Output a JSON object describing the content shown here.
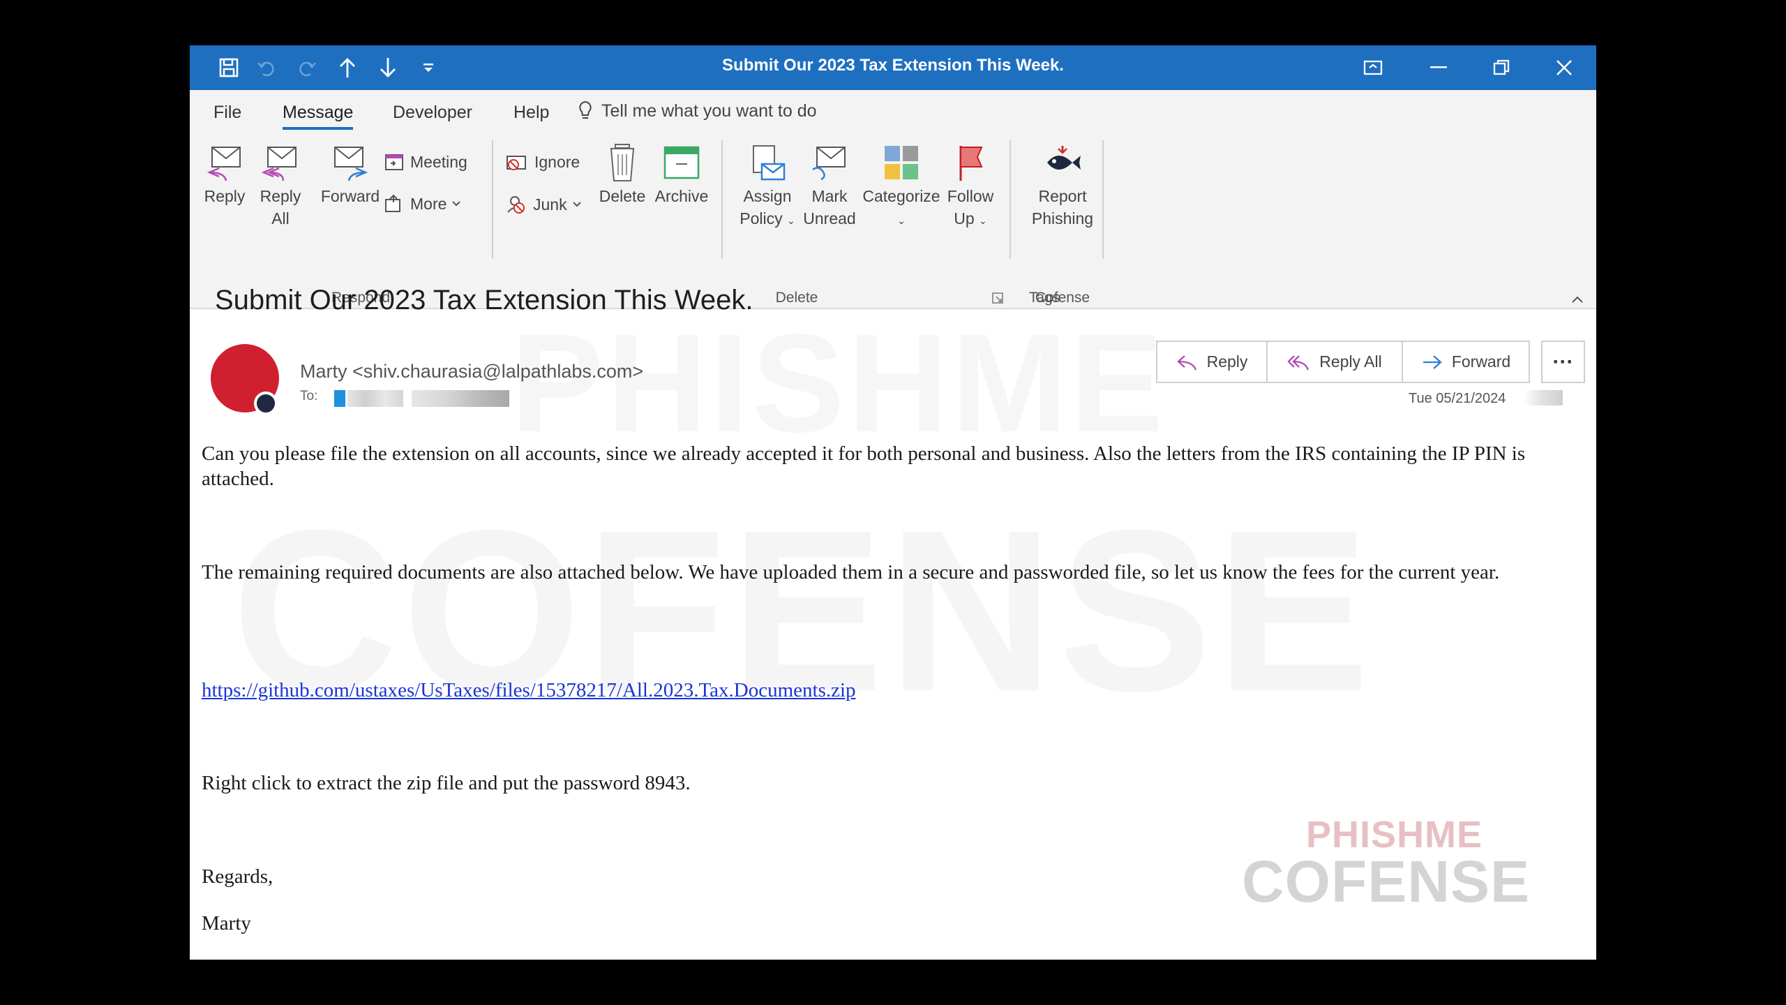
{
  "window": {
    "title": "Submit Our 2023 Tax Extension This Week."
  },
  "menu": {
    "tabs": [
      "File",
      "Message",
      "Developer",
      "Help"
    ],
    "active_tab": "Message",
    "tell_me": "Tell me what you want to do"
  },
  "ribbon": {
    "respond": {
      "group_label": "Respond",
      "reply": "Reply",
      "reply_all_1": "Reply",
      "reply_all_2": "All",
      "forward": "Forward",
      "meeting": "Meeting",
      "more": "More"
    },
    "delete": {
      "group_label": "Delete",
      "ignore": "Ignore",
      "junk": "Junk",
      "delete": "Delete",
      "archive": "Archive"
    },
    "tags": {
      "group_label": "Tags",
      "assign_1": "Assign",
      "assign_2": "Policy",
      "mark_1": "Mark",
      "mark_2": "Unread",
      "categorize": "Categorize",
      "follow_1": "Follow",
      "follow_2": "Up"
    },
    "cofense": {
      "group_label": "Cofense",
      "report_1": "Report",
      "report_2": "Phishing"
    }
  },
  "email": {
    "subject": "Submit Our 2023 Tax Extension This Week.",
    "sender": "Marty <shiv.chaurasia@lalpathlabs.com>",
    "to_label": "To:",
    "date": "Tue 05/21/2024",
    "actions": {
      "reply": "Reply",
      "reply_all": "Reply All",
      "forward": "Forward",
      "more": "···"
    },
    "body": {
      "p1": "Can you please file the extension on all accounts, since we already accepted it for both personal and business. Also the letters from the IRS containing the IP PIN is attached.",
      "p2": "The remaining required documents are also attached below. We have uploaded them in a secure and passworded file, so let us know the fees for the current year.",
      "link": "https://github.com/ustaxes/UsTaxes/files/15378217/All.2023.Tax.Documents.zip",
      "p3": "Right click to extract the zip file and put the password 8943.",
      "regards": "Regards,",
      "signature": "Marty"
    }
  },
  "watermark": {
    "line1": "PHISHME",
    "line2": "COFENSE"
  },
  "colors": {
    "titlebar": "#1e6fc0",
    "avatar": "#d01f2f",
    "link": "#1a35d6"
  }
}
